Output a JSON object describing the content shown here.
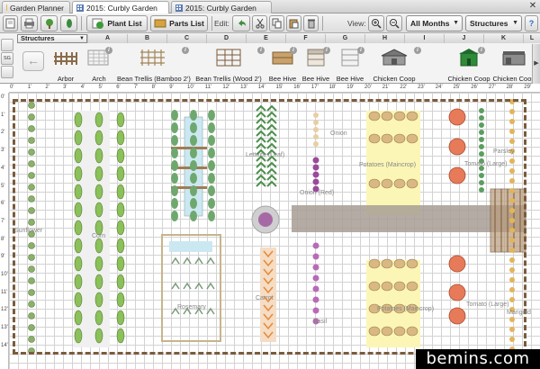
{
  "tabs": [
    {
      "label": "Garden Planner",
      "active": false
    },
    {
      "label": "2015: Curbly Garden",
      "active": true
    },
    {
      "label": "2015: Curbly Garden",
      "active": false
    }
  ],
  "tab_close": "✕",
  "toolbar": {
    "plant_list": "Plant List",
    "parts_list": "Parts List",
    "edit_label": "Edit:",
    "view_label": "View:",
    "months_select": "All Months",
    "category_select": "Structures"
  },
  "objects_bar": {
    "category": "Structures",
    "columns": [
      "A",
      "B",
      "C",
      "D",
      "E",
      "F",
      "G",
      "H",
      "I",
      "J",
      "K",
      "L"
    ],
    "items": [
      {
        "label": "Arbor",
        "icon": "arbor-icon"
      },
      {
        "label": "Arch",
        "icon": "arch-icon"
      },
      {
        "label": "Bean Trellis (Bamboo 2')",
        "icon": "bamboo-trellis-icon"
      },
      {
        "label": "Bean Trellis (Wood 2')",
        "icon": "wood-trellis-icon"
      },
      {
        "label": "Bee Hive",
        "icon": "bee-hive-icon"
      },
      {
        "label": "Bee Hive",
        "icon": "bee-hive-icon"
      },
      {
        "label": "Bee Hive",
        "icon": "bee-hive-icon"
      },
      {
        "label": "Chicken Coop",
        "icon": "chicken-coop-icon"
      },
      {
        "label": "Chicken Coop",
        "icon": "chicken-coop-icon"
      },
      {
        "label": "Chicken Coop",
        "icon": "chicken-coop-icon"
      }
    ],
    "info_glyph": "i",
    "side_tabs": [
      "",
      "SG",
      ""
    ]
  },
  "rulers": {
    "top": [
      "0'",
      "1'",
      "2'",
      "3'",
      "4'",
      "5'",
      "6'",
      "7'",
      "8'",
      "9'",
      "10'",
      "11'",
      "12'",
      "13'",
      "14'",
      "15'",
      "16'",
      "17'",
      "18'",
      "19'",
      "20'",
      "21'",
      "22'",
      "23'",
      "24'",
      "25'",
      "26'",
      "27'",
      "28'",
      "29'"
    ],
    "left": [
      "0'",
      "1'",
      "2'",
      "3'",
      "4'",
      "5'",
      "6'",
      "7'",
      "8'",
      "9'",
      "10'",
      "11'",
      "12'",
      "13'",
      "14'"
    ]
  },
  "plan_labels": {
    "sunflower": "Sunflower",
    "corn": "Corn",
    "lettuce": "Lettuce (Leaf)",
    "onion": "Onion",
    "onion_red": "Onion (Red)",
    "potatoes_top": "Potatoes (Maincrop)",
    "potatoes_bottom": "Potatoes (Maincrop)",
    "tomato_top": "Tomato (Large)",
    "tomato_bottom": "Tomato (Large)",
    "rosemary": "Rosemary",
    "carrot": "Carrot",
    "basil": "Basil",
    "marigold": "Marigold",
    "parsley": "Parsley"
  },
  "watermark": "bemins.com",
  "colors": {
    "fence": "#7a5b3c",
    "path": "#a79d94",
    "potato_zone": "#fbf6b5",
    "trellis": "#b99b7c"
  }
}
